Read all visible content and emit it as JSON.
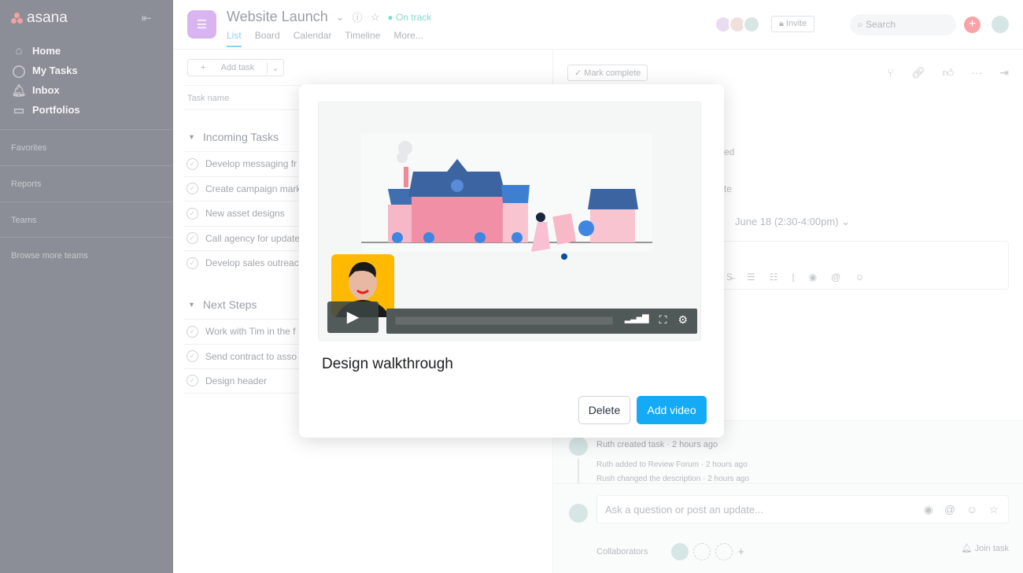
{
  "sidebar": {
    "logo": "asana",
    "nav": [
      {
        "label": "Home",
        "icon": "home-icon"
      },
      {
        "label": "My Tasks",
        "icon": "check-circle-icon"
      },
      {
        "label": "Inbox",
        "icon": "bell-icon"
      },
      {
        "label": "Portfolios",
        "icon": "chart-icon"
      }
    ],
    "sections": [
      "Favorites",
      "Reports",
      "Teams",
      "Browse more teams"
    ]
  },
  "header": {
    "title": "Website Launch",
    "status": "On track",
    "status_color": "#7fdcd0",
    "tabs": [
      "List",
      "Board",
      "Calendar",
      "Timeline",
      "More..."
    ],
    "invite": "Invite",
    "search_placeholder": "Search"
  },
  "list": {
    "add_task": "Add task",
    "column": "Task name",
    "groups": [
      {
        "name": "Incoming Tasks",
        "tasks": [
          "Develop messaging fr",
          "Create campaign mark",
          "New asset designs",
          "Call agency for update",
          "Develop sales outreac"
        ]
      },
      {
        "name": "Next Steps",
        "tasks": [
          "Work with Tim in the f",
          "Send contract to asso",
          "Design header"
        ]
      }
    ]
  },
  "detail": {
    "mark_complete": "Mark complete",
    "frag1": "ed",
    "frag2": "te",
    "date": "June 18 (2:30-4:00pm)",
    "activity": {
      "created": "Ruth created task",
      "created_time": "2 hours ago",
      "items": [
        {
          "text": "Ruth added to Review Forum",
          "time": "2 hours ago"
        },
        {
          "text": "Rush changed the description",
          "time": "2 hours ago"
        }
      ]
    },
    "comment_placeholder": "Ask a question or post an update...",
    "collaborators": "Collaborators",
    "join": "Join task"
  },
  "modal": {
    "title": "Design walkthrough",
    "delete": "Delete",
    "add_video": "Add video",
    "accent": "#14aaf5",
    "video_progress": 0
  }
}
